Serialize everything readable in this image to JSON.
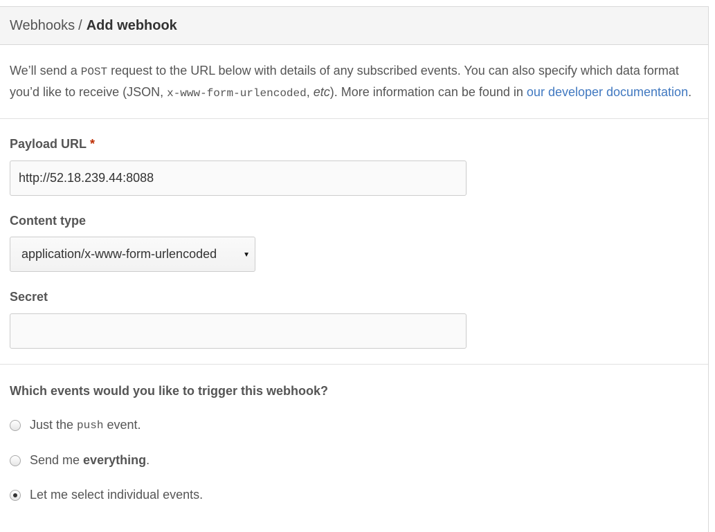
{
  "breadcrumb": {
    "parent": "Webhooks",
    "separator": "/",
    "current": "Add webhook"
  },
  "intro": {
    "part1": "We’ll send a ",
    "code_post": "POST",
    "part2": " request to the URL below with details of any subscribed events. You can also specify which data format you’d like to receive (JSON, ",
    "code_format": "x-www-form-urlencoded",
    "part3": ", ",
    "etc": "etc",
    "part4": "). More information can be found in ",
    "link": "our developer documentation",
    "part5": "."
  },
  "form": {
    "payload_url": {
      "label": "Payload URL",
      "required_marker": "*",
      "value": "http://52.18.239.44:8088"
    },
    "content_type": {
      "label": "Content type",
      "selected": "application/x-www-form-urlencoded"
    },
    "secret": {
      "label": "Secret",
      "value": ""
    }
  },
  "events": {
    "title": "Which events would you like to trigger this webhook?",
    "option_push": {
      "prefix": "Just the",
      "code": "push",
      "suffix": "event.",
      "checked": false
    },
    "option_everything": {
      "prefix": "Send me",
      "bold": "everything",
      "suffix": ".",
      "checked": false
    },
    "option_individual": {
      "label": "Let me select individual events.",
      "checked": true
    }
  },
  "colors": {
    "link": "#4078c0",
    "required": "#bd2c00",
    "header_bg": "#f5f5f5"
  }
}
